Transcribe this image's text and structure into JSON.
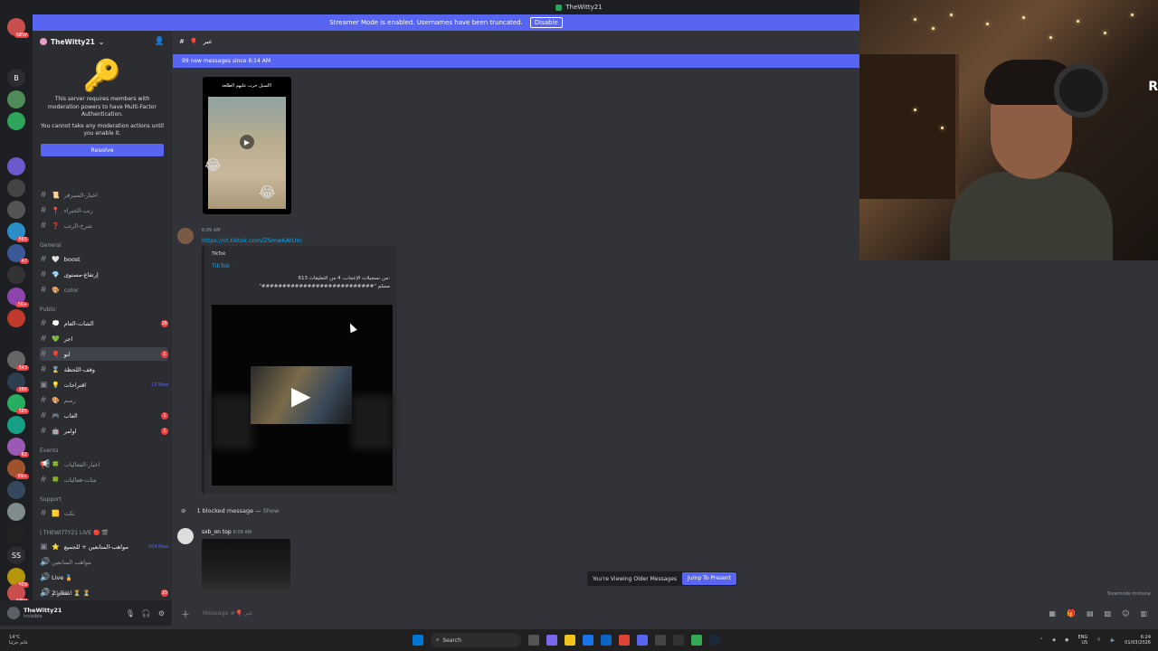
{
  "window": {
    "title": "TheWitty21"
  },
  "streamer_banner": {
    "text": "Streamer Mode is enabled. Usernames have been truncated.",
    "button": "Disable"
  },
  "guilds": [
    {
      "badge": "NEW"
    },
    {
      "label": "B"
    },
    {
      "badge": ""
    },
    {
      "badge": "865"
    },
    {
      "badge": "47"
    },
    {
      "badge": "3K+"
    },
    {
      "badge": "343"
    },
    {
      "badge": "386"
    },
    {
      "badge": "385"
    },
    {
      "badge": "62"
    },
    {
      "badge": "99+"
    },
    {
      "label": "SS"
    },
    {
      "badge": "909"
    },
    {
      "badge": "NEW"
    }
  ],
  "server": {
    "name": "TheWitty21",
    "mfa_text": "This server requires members with moderation powers to have Multi-Factor Authentication.",
    "mfa_sub": "You cannot take any moderation actions until you enable it.",
    "resolve": "Resolve"
  },
  "channels_top": [
    {
      "emoji": "📜",
      "name": "اخبار-السيرفر"
    },
    {
      "emoji": "📍",
      "name": "رتب-الخبراء"
    },
    {
      "emoji": "❓",
      "name": "شرح-الرتب"
    }
  ],
  "cat_general": "General",
  "channels_general": [
    {
      "emoji": "🤍",
      "name": "boost"
    },
    {
      "emoji": "💎",
      "name": "إرتفاع-مستوى"
    },
    {
      "emoji": "🎨",
      "name": "color"
    }
  ],
  "cat_public": "Public",
  "channels_public": [
    {
      "emoji": "💭",
      "name": "الشات-العام",
      "count": "26"
    },
    {
      "emoji": "💚",
      "name": "اجر"
    },
    {
      "emoji": "🎈",
      "name": "ابو",
      "count": "1"
    },
    {
      "emoji": "⌛",
      "name": "وقف-اللحظة"
    },
    {
      "emoji": "💡",
      "name": "اقتراحات",
      "new": "13 New"
    },
    {
      "emoji": "🎨",
      "name": "رسم"
    },
    {
      "emoji": "🎮",
      "name": "العاب",
      "count": "1"
    },
    {
      "emoji": "🤖",
      "name": "اوامر",
      "count": "1"
    }
  ],
  "cat_events": "Events",
  "channels_events": [
    {
      "emoji": "🍀",
      "name": "اخبار-الفعاليات"
    },
    {
      "emoji": "🍀",
      "name": "شات-فعاليات"
    }
  ],
  "cat_support": "Support",
  "channels_support": [
    {
      "emoji": "🟨",
      "name": "تكت"
    }
  ],
  "cat_live": "| THEWITTY21 LIVE 🔴 🎬",
  "channels_live": [
    {
      "emoji": "⭐",
      "name": "مواهب-المتابعين + للجميع",
      "new": "104 New"
    },
    {
      "emoji": "",
      "name": "مواهب المتابعين"
    },
    {
      "emoji": "",
      "name": "Live 🏅"
    },
    {
      "emoji": "",
      "name": "انتظار 2 ⏳ ⏳"
    },
    {
      "emoji": "",
      "name": "الانتظار",
      "count": "20"
    }
  ],
  "user": {
    "name": "TheWitty21",
    "status": "Invisible"
  },
  "channel_header": {
    "name": "عبر"
  },
  "new_messages": "99 new messages since 6:14 AM",
  "messages": {
    "pic_caption": "السيل خرب عليهم الطلعة!",
    "m2_time": "6:09 AM",
    "m2_link": "https://vt.tiktok.com/ZSmw6AtUV/",
    "embed_provider": "TikTok",
    "embed_author": "TikTok ·",
    "embed_desc": "613 من تسجيلات الإعجاب، 4 من التعليقات:",
    "embed_desc2": "\"###########################\" مسلم",
    "blocked": "1 blocked message —",
    "blocked_show": "Show",
    "m3_author": "sxb_on top",
    "m3_time": "6:09 AM"
  },
  "older": {
    "text": "You're Viewing Older Messages",
    "button": "Jump To Present"
  },
  "slowmode": "Slowmode Immune",
  "input": {
    "placeholder": "Message #🎈 عبر"
  },
  "taskbar": {
    "weather_temp": "14°C",
    "weather_desc": "غائم جزئيا",
    "search": "Search",
    "lang": "ENG",
    "lang2": "US",
    "time": "6:24",
    "date": "01/03/2026"
  }
}
